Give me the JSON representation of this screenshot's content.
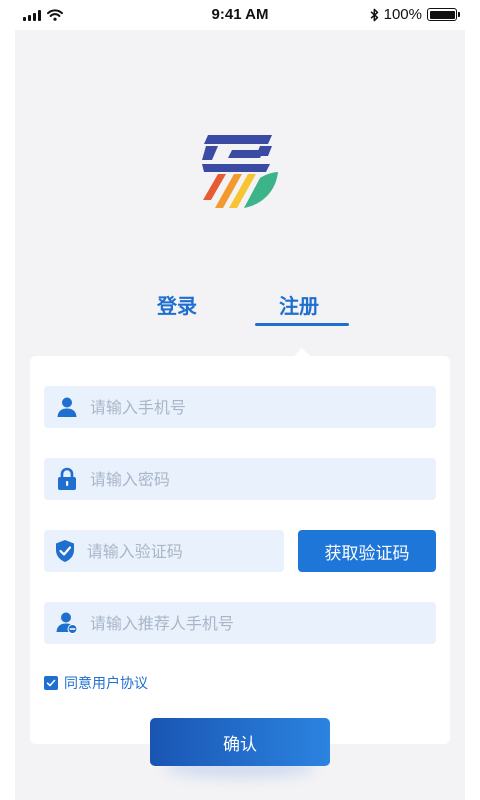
{
  "status_bar": {
    "time": "9:41 AM",
    "battery": "100%",
    "battery_level": 1.0,
    "icons": [
      "signal-icon",
      "wifi-icon",
      "bluetooth-icon",
      "battery-icon"
    ]
  },
  "logo": {
    "icon": "app-logo"
  },
  "tabs": {
    "login": "登录",
    "register": "注册",
    "active": "register"
  },
  "form": {
    "phone": {
      "placeholder": "请输入手机号",
      "value": "",
      "icon": "user-icon"
    },
    "password": {
      "placeholder": "请输入密码",
      "value": "",
      "icon": "lock-icon"
    },
    "code": {
      "placeholder": "请输入验证码",
      "value": "",
      "icon": "shield-check-icon"
    },
    "code_button": "获取验证码",
    "referrer": {
      "placeholder": "请输入推荐人手机号",
      "value": "",
      "icon": "user-referral-icon"
    },
    "agree_checked": true,
    "agree_label": "同意用户协议",
    "confirm_button": "确认"
  },
  "colors": {
    "accent": "#1f6fd0",
    "field_bg": "#e9f1fc",
    "page_bg": "#f3f3f5"
  }
}
